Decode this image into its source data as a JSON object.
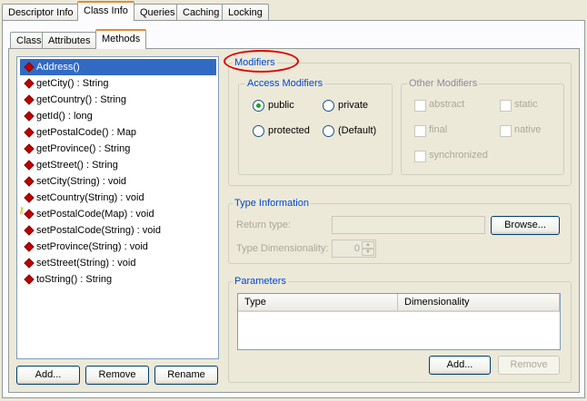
{
  "top_tabs": [
    "Descriptor Info",
    "Class Info",
    "Queries",
    "Caching",
    "Locking"
  ],
  "sub_tabs": [
    "Class",
    "Attributes",
    "Methods"
  ],
  "methods": [
    {
      "label": "Address()",
      "selected": true,
      "icon": "method-diamond-icon"
    },
    {
      "label": "getCity() : String",
      "icon": "method-diamond-icon"
    },
    {
      "label": "getCountry() : String",
      "icon": "method-diamond-icon"
    },
    {
      "label": "getId() : long",
      "icon": "method-diamond-icon"
    },
    {
      "label": "getPostalCode() : Map",
      "icon": "method-diamond-icon"
    },
    {
      "label": "getProvince() : String",
      "icon": "method-diamond-icon"
    },
    {
      "label": "getStreet() : String",
      "icon": "method-diamond-icon"
    },
    {
      "label": "setCity(String) : void",
      "icon": "method-diamond-icon"
    },
    {
      "label": "setCountry(String) : void",
      "icon": "method-diamond-icon"
    },
    {
      "label": "setPostalCode(Map) : void",
      "icon": "method-diamond-icon",
      "key": true
    },
    {
      "label": "setPostalCode(String) : void",
      "icon": "method-diamond-icon"
    },
    {
      "label": "setProvince(String) : void",
      "icon": "method-diamond-icon"
    },
    {
      "label": "setStreet(String) : void",
      "icon": "method-diamond-icon"
    },
    {
      "label": "toString() : String",
      "icon": "method-diamond-icon"
    }
  ],
  "list_buttons": {
    "add": "Add...",
    "remove": "Remove",
    "rename": "Rename"
  },
  "modifiers": {
    "title": "Modifiers",
    "access": {
      "title": "Access Modifiers",
      "options": [
        "public",
        "private",
        "protected",
        "(Default)"
      ],
      "selected": "public"
    },
    "other": {
      "title": "Other Modifiers",
      "options": [
        "abstract",
        "static",
        "final",
        "native",
        "synchronized"
      ]
    }
  },
  "type_info": {
    "title": "Type Information",
    "return_type_label": "Return type:",
    "return_type_value": "",
    "browse": "Browse...",
    "dimensionality_label": "Type Dimensionality:",
    "dimensionality_value": "0"
  },
  "parameters": {
    "title": "Parameters",
    "columns": [
      "Type",
      "Dimensionality"
    ],
    "add": "Add...",
    "remove": "Remove"
  },
  "colors": {
    "selection": "#316ac5",
    "group_title": "#0046d5",
    "annotation": "#e00000",
    "tab_accent": "#e68b2c"
  }
}
